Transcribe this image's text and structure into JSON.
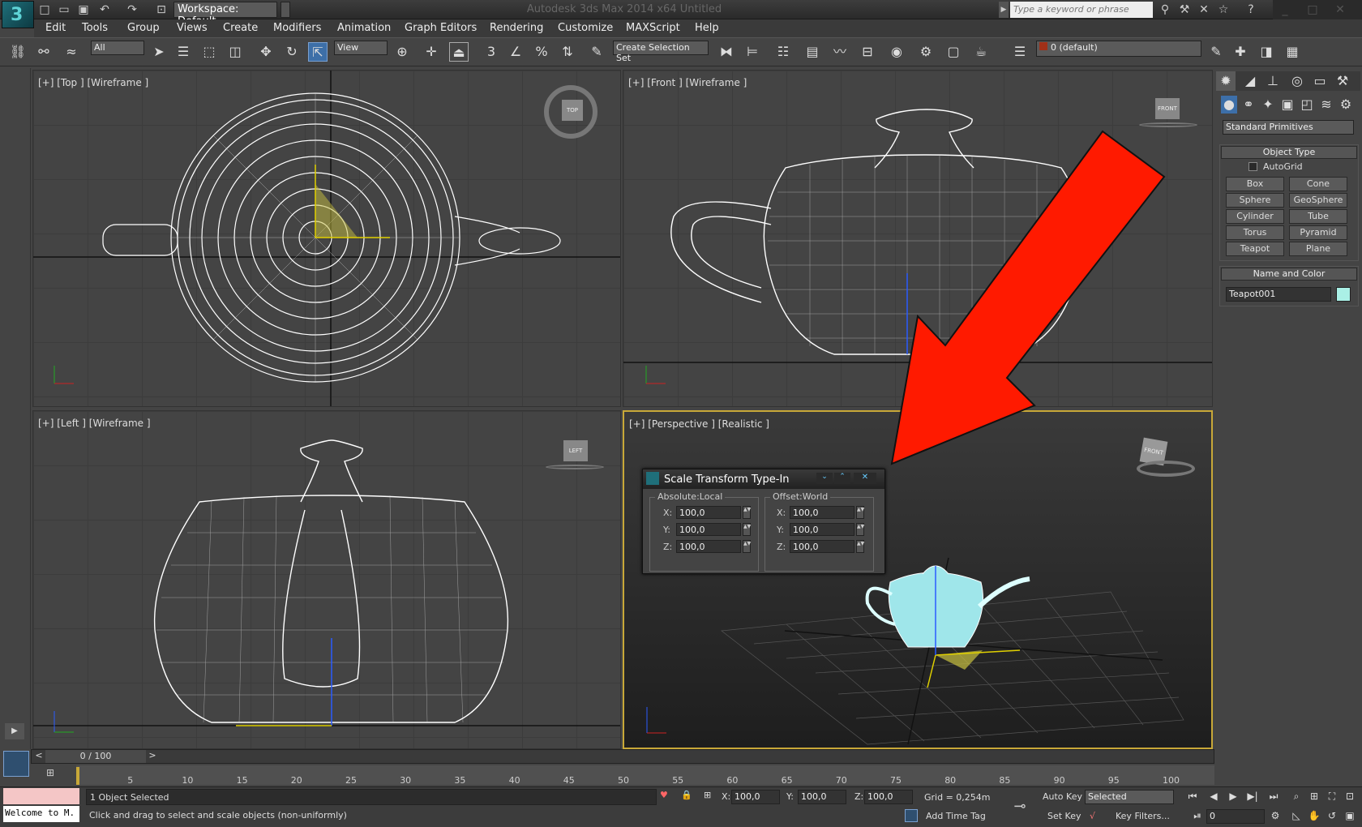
{
  "titlebar": {
    "workspace": "Workspace: Default",
    "app_title": "Autodesk 3ds Max 2014 x64    Untitled",
    "search_placeholder": "Type a keyword or phrase"
  },
  "menu": [
    "Edit",
    "Tools",
    "Group",
    "Views",
    "Create",
    "Modifiers",
    "Animation",
    "Graph Editors",
    "Rendering",
    "Customize",
    "MAXScript",
    "Help"
  ],
  "toolbar": {
    "filter": "All",
    "ref_coord": "View",
    "named_selection": "Create Selection Set",
    "layer": "0 (default)",
    "snap_labels": [
      "3",
      "%"
    ]
  },
  "viewports": {
    "top": "[+] [Top ] [Wireframe ]",
    "front": "[+] [Front ] [Wireframe ]",
    "left": "[+] [Left ] [Wireframe ]",
    "perspective": "[+] [Perspective ] [Realistic ]",
    "viewcube_top": "TOP",
    "viewcube_front": "FRONT",
    "viewcube_left": "LEFT",
    "viewcube_persp": "FRONT"
  },
  "command_panel": {
    "category": "Standard Primitives",
    "object_type_header": "Object Type",
    "autogrid": "AutoGrid",
    "buttons": [
      "Box",
      "Cone",
      "Sphere",
      "GeoSphere",
      "Cylinder",
      "Tube",
      "Torus",
      "Pyramid",
      "Teapot",
      "Plane"
    ],
    "name_color_header": "Name and Color",
    "object_name": "Teapot001",
    "object_color": "#aaf0e6"
  },
  "dialog": {
    "title": "Scale Transform Type-In",
    "absolute_label": "Absolute:Local",
    "offset_label": "Offset:World",
    "absolute": {
      "x": "100,0",
      "y": "100,0",
      "z": "100,0"
    },
    "offset": {
      "x": "100,0",
      "y": "100,0",
      "z": "100,0"
    },
    "axis_x": "X:",
    "axis_y": "Y:",
    "axis_z": "Z:"
  },
  "timeline": {
    "frame": "0 / 100",
    "ticks": [
      "5",
      "10",
      "15",
      "20",
      "25",
      "30",
      "35",
      "40",
      "45",
      "50",
      "55",
      "60",
      "65",
      "70",
      "75",
      "80",
      "85",
      "90",
      "95",
      "100"
    ]
  },
  "status": {
    "maxscript": "Welcome to M.",
    "selection": "1 Object Selected",
    "prompt": "Click and drag to select and scale objects (non-uniformly)",
    "x_label": "X:",
    "y_label": "Y:",
    "z_label": "Z:",
    "x": "100,0",
    "y": "100,0",
    "z": "100,0",
    "grid": "Grid = 0,254m",
    "auto_key": "Auto Key",
    "set_key": "Set Key",
    "key_mode": "Selected",
    "key_filters": "Key Filters...",
    "add_time_tag": "Add Time Tag",
    "current_frame": "0"
  },
  "colors": {
    "arrow": "#ff1a00",
    "viewport_active_border": "#c8a838",
    "accent_blue": "#3d6fa8"
  }
}
